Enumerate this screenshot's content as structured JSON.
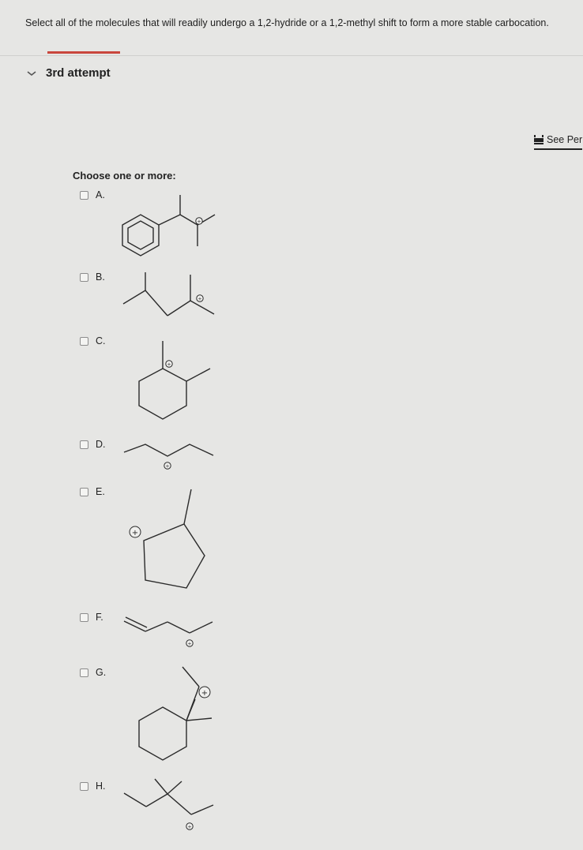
{
  "question": {
    "text": "Select all of the molecules that will readily undergo a 1,2-hydride or a 1,2-methyl shift to form a more stable carbocation."
  },
  "attempt": {
    "label": "3rd attempt",
    "icon": "chevron-down-icon"
  },
  "see_periodic_table": {
    "label": "See Per",
    "icon": "periodic-table-icon"
  },
  "choose_label": "Choose one or more:",
  "options": [
    {
      "label": "A."
    },
    {
      "label": "B."
    },
    {
      "label": "C."
    },
    {
      "label": "D."
    },
    {
      "label": "E."
    },
    {
      "label": "F."
    },
    {
      "label": "G."
    },
    {
      "label": "H."
    }
  ],
  "charge_symbol": "+",
  "colors": {
    "accent": "#c9463d",
    "background": "#e6e6e4",
    "text": "#222222"
  }
}
